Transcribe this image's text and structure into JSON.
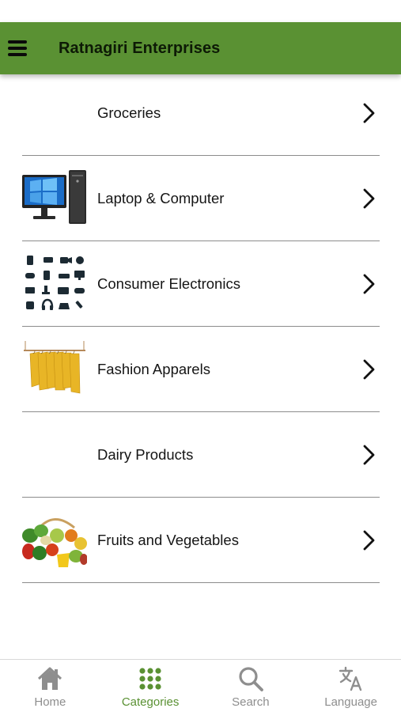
{
  "header": {
    "title": "Ratnagiri Enterprises",
    "color": "#5a9133"
  },
  "categories": [
    {
      "label": "Groceries",
      "image": "none"
    },
    {
      "label": "Laptop & Computer",
      "image": "desktop-computer-image"
    },
    {
      "label": "Consumer Electronics",
      "image": "electronics-icon-grid-image"
    },
    {
      "label": "Fashion Apparels",
      "image": "hanging-garments-image"
    },
    {
      "label": "Dairy Products",
      "image": "none"
    },
    {
      "label": "Fruits and Vegetables",
      "image": "fruit-basket-image"
    }
  ],
  "tabs": [
    {
      "label": "Home",
      "icon": "home-icon",
      "active": false
    },
    {
      "label": "Categories",
      "icon": "grid-dots-icon",
      "active": true
    },
    {
      "label": "Search",
      "icon": "search-icon",
      "active": false
    },
    {
      "label": "Language",
      "icon": "translate-icon",
      "active": false
    }
  ],
  "colors": {
    "accent": "#5a9133",
    "inactive_tab": "#8e8e8e"
  }
}
